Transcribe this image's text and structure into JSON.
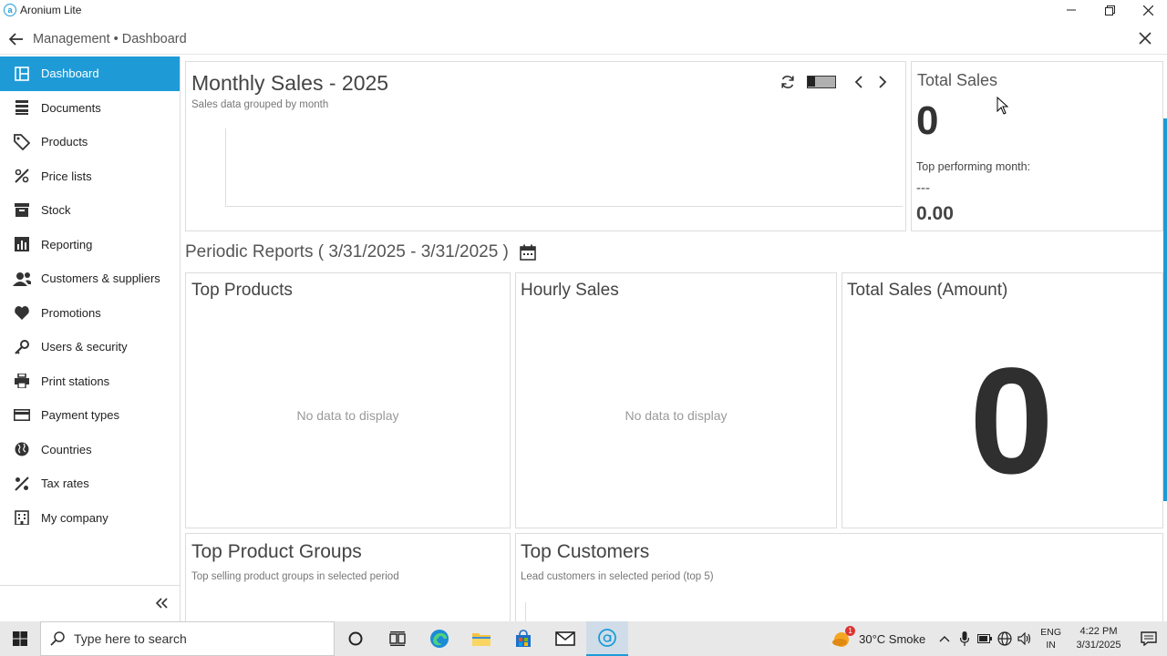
{
  "window": {
    "title": "Aronium Lite",
    "logo_letter": "a"
  },
  "header": {
    "breadcrumb": "Management • Dashboard"
  },
  "sidebar": {
    "items": [
      {
        "label": "Dashboard",
        "icon": "dashboard-icon",
        "active": true
      },
      {
        "label": "Documents",
        "icon": "documents-icon"
      },
      {
        "label": "Products",
        "icon": "tag-icon"
      },
      {
        "label": "Price lists",
        "icon": "price-list-icon"
      },
      {
        "label": "Stock",
        "icon": "box-icon"
      },
      {
        "label": "Reporting",
        "icon": "bar-chart-icon"
      },
      {
        "label": "Customers & suppliers",
        "icon": "users-icon"
      },
      {
        "label": "Promotions",
        "icon": "heart-icon"
      },
      {
        "label": "Users & security",
        "icon": "key-icon"
      },
      {
        "label": "Print stations",
        "icon": "printer-icon"
      },
      {
        "label": "Payment types",
        "icon": "credit-card-icon"
      },
      {
        "label": "Countries",
        "icon": "globe-icon"
      },
      {
        "label": "Tax rates",
        "icon": "percent-icon"
      },
      {
        "label": "My company",
        "icon": "building-icon"
      }
    ]
  },
  "monthly_sales": {
    "title": "Monthly Sales - 2025",
    "subtitle": "Sales data grouped by month"
  },
  "total_sales": {
    "title": "Total Sales",
    "value": "0",
    "top_month_label": "Top performing month:",
    "top_month": "---",
    "top_month_amount": "0.00"
  },
  "periodic_reports": {
    "title": "Periodic Reports ( 3/31/2025 - 3/31/2025 )"
  },
  "top_products": {
    "title": "Top Products",
    "empty": "No data to display"
  },
  "hourly_sales": {
    "title": "Hourly Sales",
    "empty": "No data to display"
  },
  "total_sales_amount": {
    "title": "Total Sales (Amount)",
    "value": "0"
  },
  "top_product_groups": {
    "title": "Top Product Groups",
    "subtitle": "Top selling product groups in selected period"
  },
  "top_customers": {
    "title": "Top Customers",
    "subtitle": "Lead customers in selected period (top 5)"
  },
  "taskbar": {
    "search_placeholder": "Type here to search",
    "weather": "30°C  Smoke",
    "weather_badge": "1",
    "lang_line1": "ENG",
    "lang_line2": "IN",
    "time": "4:22 PM",
    "date": "3/31/2025"
  },
  "colors": {
    "accent": "#1e9bd7"
  }
}
